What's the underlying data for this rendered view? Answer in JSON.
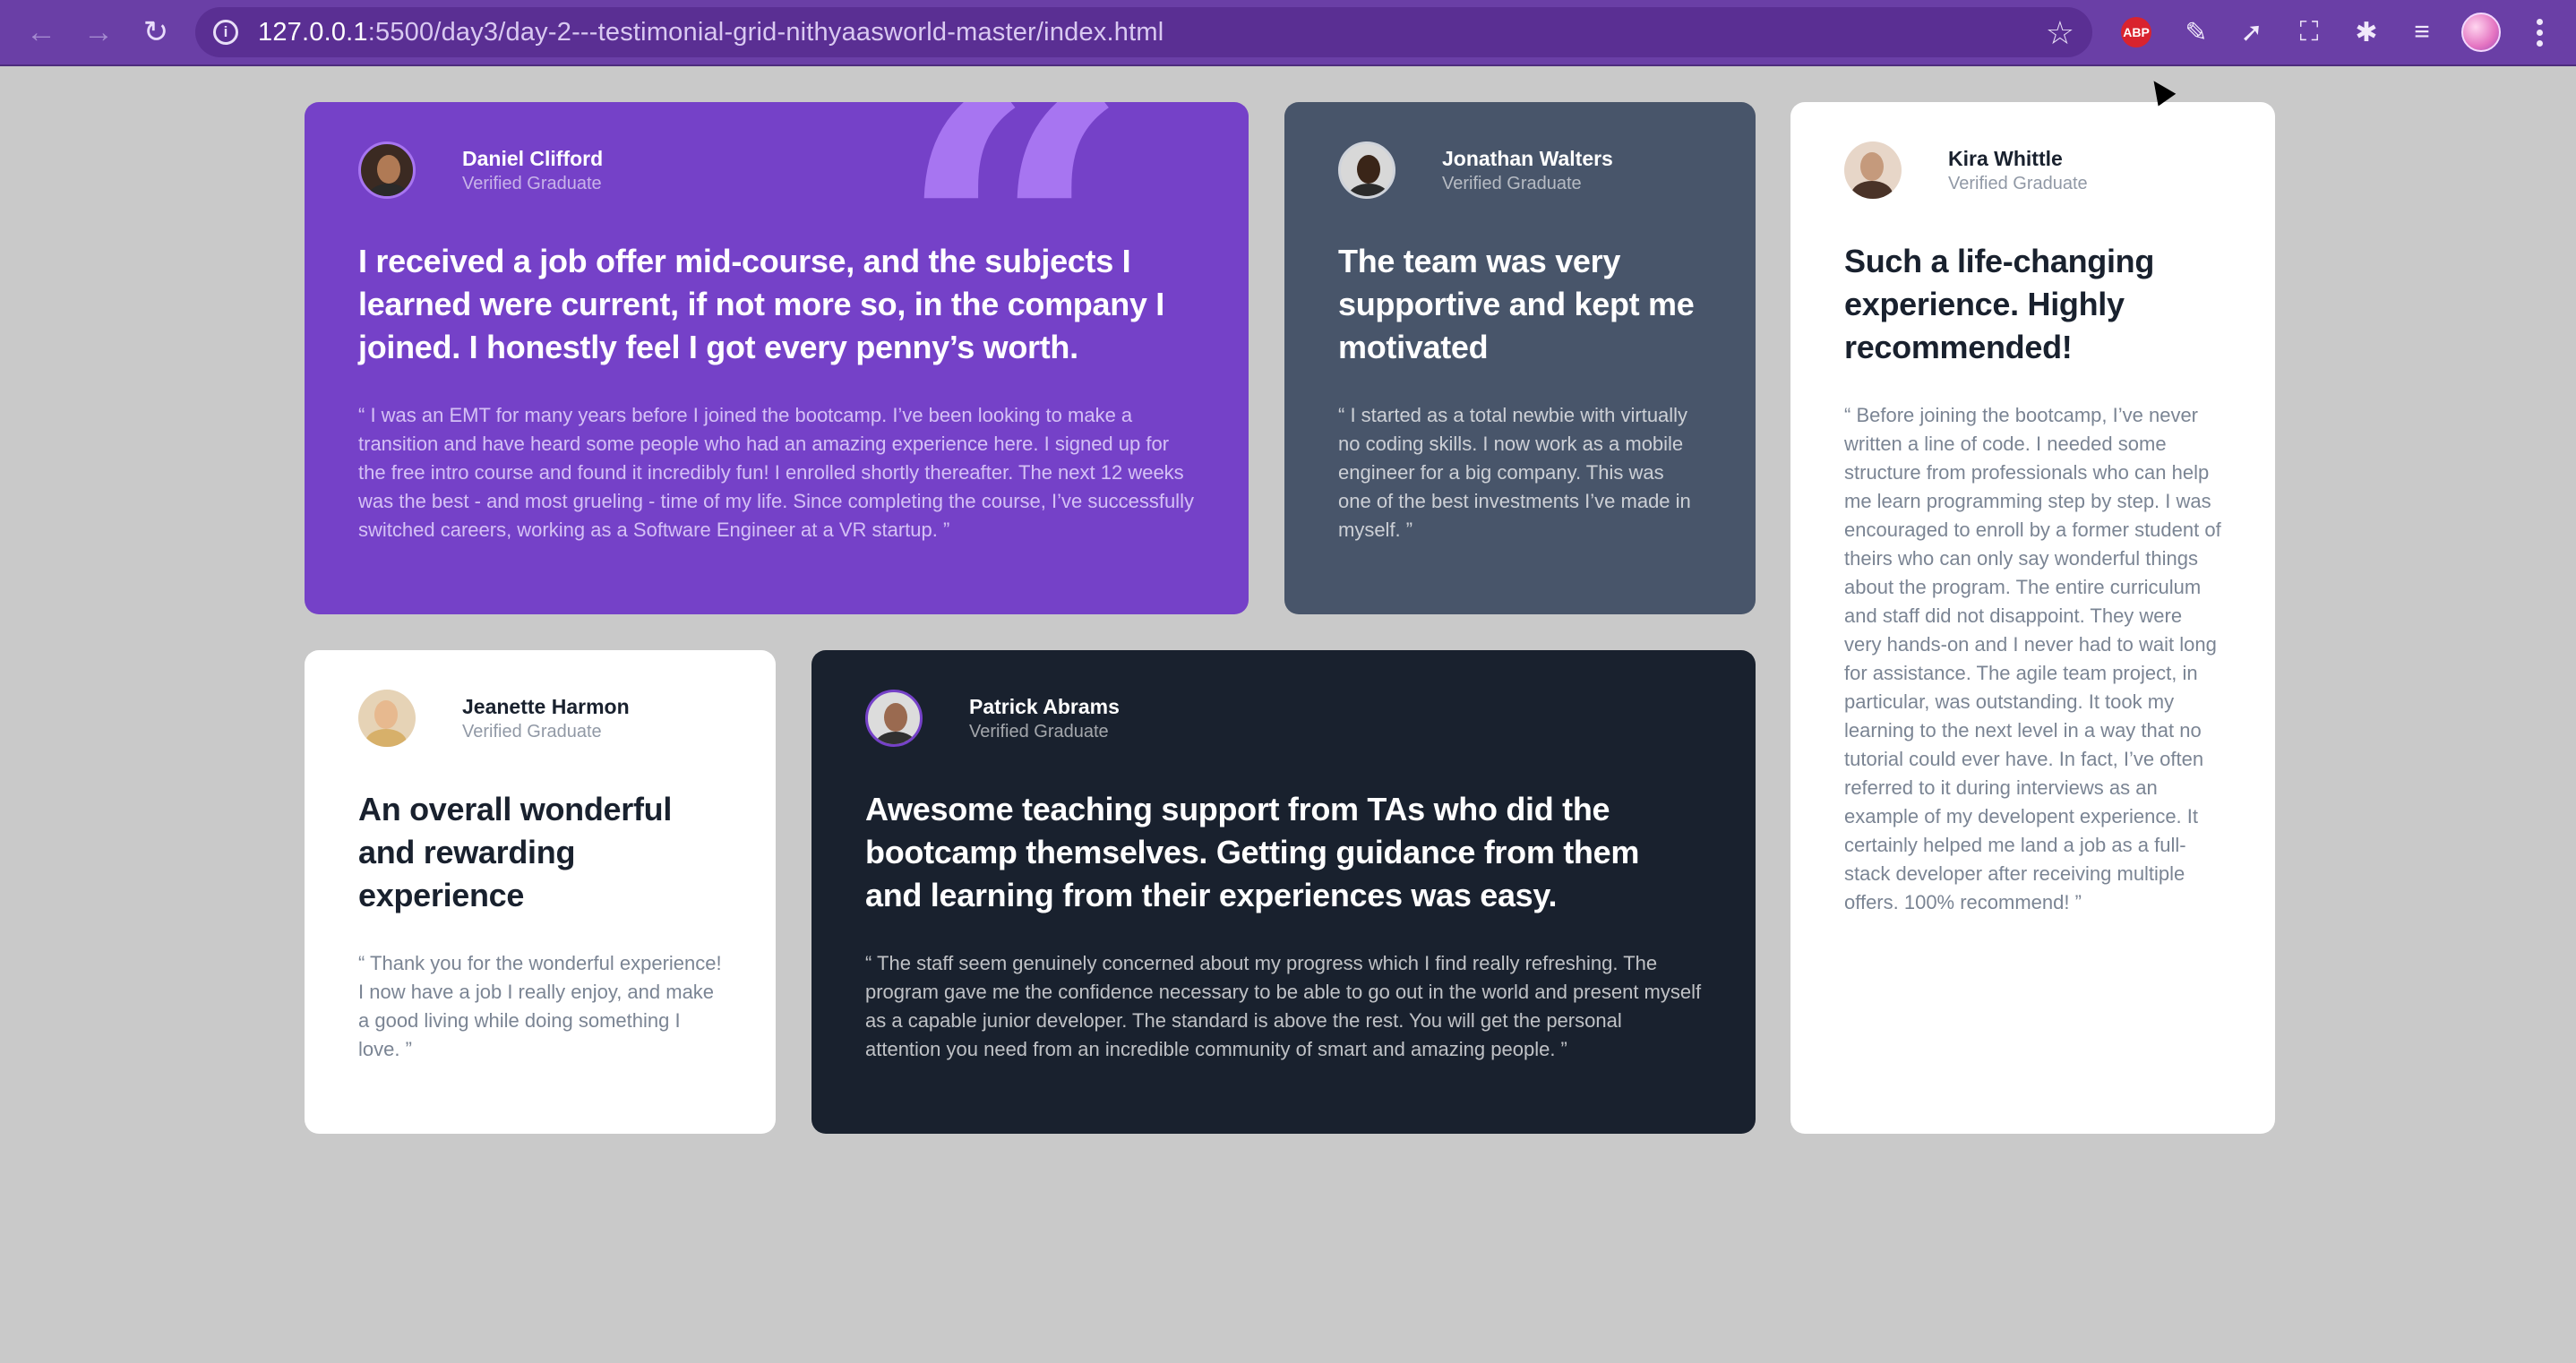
{
  "browser": {
    "url_host": "127.0.0.1",
    "url_rest": ":5500/day3/day-2---testimonial-grid-nithyaasworld-master/index.html",
    "abp_label": "ABP",
    "icons": [
      "back-icon",
      "forward-icon",
      "reload-icon",
      "info-icon",
      "star-icon",
      "extensions-icon",
      "menu-icon"
    ]
  },
  "testimonials": [
    {
      "name": "Daniel Clifford",
      "status": "Verified Graduate",
      "headline": "I received a job offer mid-course, and the subjects I learned were current, if not more so, in the company I joined. I honestly feel I got every penny’s worth.",
      "quote": "“ I was an EMT for many years before I joined the bootcamp. I’ve been looking to make a transition and have heard some people who had an amazing experience here. I signed up for the free intro course and found it incredibly fun! I enrolled shortly thereafter. The next 12 weeks was the best - and most grueling - time of my life. Since completing the course, I’ve successfully switched careers, working as a Software Engineer at a VR startup. ”"
    },
    {
      "name": "Jonathan Walters",
      "status": "Verified Graduate",
      "headline": "The team was very supportive and kept me motivated",
      "quote": "“ I started as a total newbie with virtually no coding skills. I now work as a mobile engineer for a big company. This was one of the best investments I’ve made in myself. ”"
    },
    {
      "name": "Kira Whittle",
      "status": "Verified Graduate",
      "headline": "Such a life-changing experience. Highly recommended!",
      "quote": "“ Before joining the bootcamp, I’ve never written a line of code. I needed some structure from professionals who can help me learn programming step by step. I was encouraged to enroll by a former student of theirs who can only say wonderful things about the program. The entire curriculum and staff did not disappoint. They were very hands-on and I never had to wait long for assistance. The agile team project, in particular, was outstanding. It took my learning to the next level in a way that no tutorial could ever have. In fact, I’ve often referred to it during interviews as an example of my developent experience. It certainly helped me land a job as a full-stack developer after receiving multiple offers. 100% recommend! ”"
    },
    {
      "name": "Jeanette Harmon",
      "status": "Verified Graduate",
      "headline": "An overall wonderful and rewarding experience",
      "quote": "“ Thank you for the wonderful experience! I now have a job I really enjoy, and make a good living while doing something I love. ”"
    },
    {
      "name": "Patrick Abrams",
      "status": "Verified Graduate",
      "headline": "Awesome teaching support from TAs who did the bootcamp themselves. Getting guidance from them and learning from their experiences was easy.",
      "quote": "“ The staff seem genuinely concerned about my progress which I find really refreshing. The program gave me the confidence necessary to be able to go out in the world and present myself as a capable junior developer. The standard is above the rest. You will get the personal attention you need from an incredible community of smart and amazing people. ”"
    }
  ],
  "colors": {
    "page_bg": "#c9c9c9",
    "purple": "#7541c8",
    "grayish_blue": "#48556a",
    "dark_blackish_blue": "#19212e",
    "white": "#ffffff",
    "browser_chrome": "#6a3fa6"
  }
}
